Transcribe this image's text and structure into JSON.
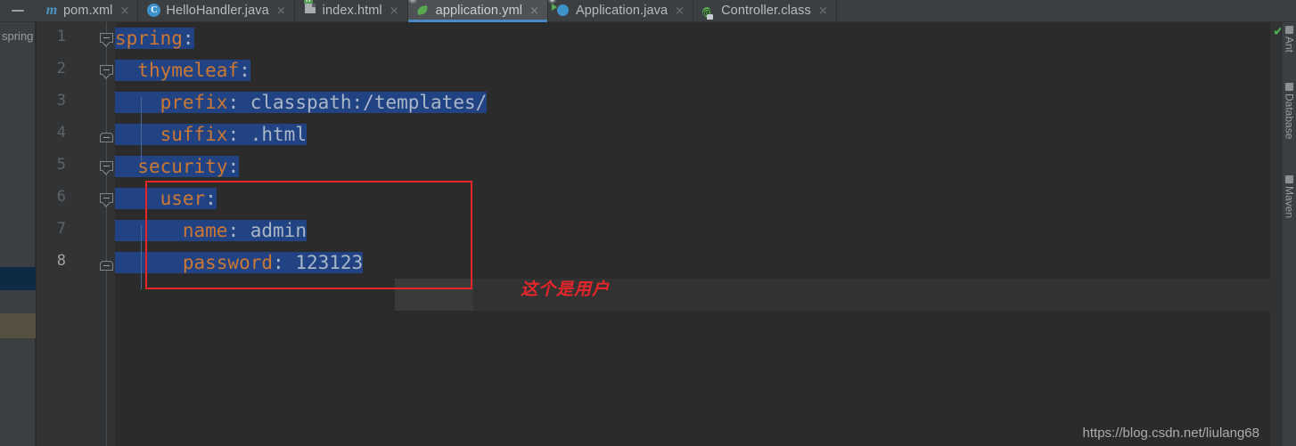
{
  "window": {
    "hide_tool_icon": "minimize-icon"
  },
  "tabs": [
    {
      "label": "pom.xml",
      "icon": "maven-file-icon",
      "active": false,
      "close": "×"
    },
    {
      "label": "HelloHandler.java",
      "icon": "java-class-icon",
      "active": false,
      "close": "×"
    },
    {
      "label": "index.html",
      "icon": "html-file-icon",
      "active": false,
      "close": "×"
    },
    {
      "label": "application.yml",
      "icon": "spring-yaml-icon",
      "active": true,
      "close": "×"
    },
    {
      "label": "Application.java",
      "icon": "spring-boot-run-icon",
      "active": false,
      "close": "×"
    },
    {
      "label": "Controller.class",
      "icon": "annotation-class-icon",
      "active": false,
      "close": "×"
    }
  ],
  "project_strip": {
    "label": "spring"
  },
  "editor": {
    "line_numbers": [
      "1",
      "2",
      "3",
      "4",
      "5",
      "6",
      "7",
      "8"
    ],
    "current_line": "8",
    "lines": [
      {
        "num": "1",
        "indent": 0,
        "key": "spring",
        "colon": ":",
        "value": ""
      },
      {
        "num": "2",
        "indent": 1,
        "key": "thymeleaf",
        "colon": ":",
        "value": ""
      },
      {
        "num": "3",
        "indent": 2,
        "key": "prefix",
        "colon": ":",
        "value": "classpath:/templates/"
      },
      {
        "num": "4",
        "indent": 2,
        "key": "suffix",
        "colon": ":",
        "value": ".html"
      },
      {
        "num": "5",
        "indent": 1,
        "key": "security",
        "colon": ":",
        "value": ""
      },
      {
        "num": "6",
        "indent": 2,
        "key": "user",
        "colon": ":",
        "value": ""
      },
      {
        "num": "7",
        "indent": 3,
        "key": "name",
        "colon": ":",
        "value": "admin"
      },
      {
        "num": "8",
        "indent": 3,
        "key": "password",
        "colon": ":",
        "value": "123123"
      }
    ]
  },
  "annotation": {
    "text": "这个是用户",
    "color": "#e8262a"
  },
  "status": {
    "inspection_ok": "✔",
    "inspection_color": "#4eae4e"
  },
  "right_tool_buttons": [
    {
      "label": "Ant",
      "icon": "ant-icon"
    },
    {
      "label": "Database",
      "icon": "database-icon"
    },
    {
      "label": "Maven",
      "icon": "maven-icon"
    }
  ],
  "watermark": {
    "text": "https://blog.csdn.net/liulang68"
  },
  "colors": {
    "selection": "#214283",
    "key": "#cc7832",
    "value": "#a9b7c6",
    "tab_active_underline": "#4a88c7",
    "editor_bg": "#2b2b2b",
    "gutter_bg": "#313335",
    "chrome_bg": "#3c3f41"
  }
}
